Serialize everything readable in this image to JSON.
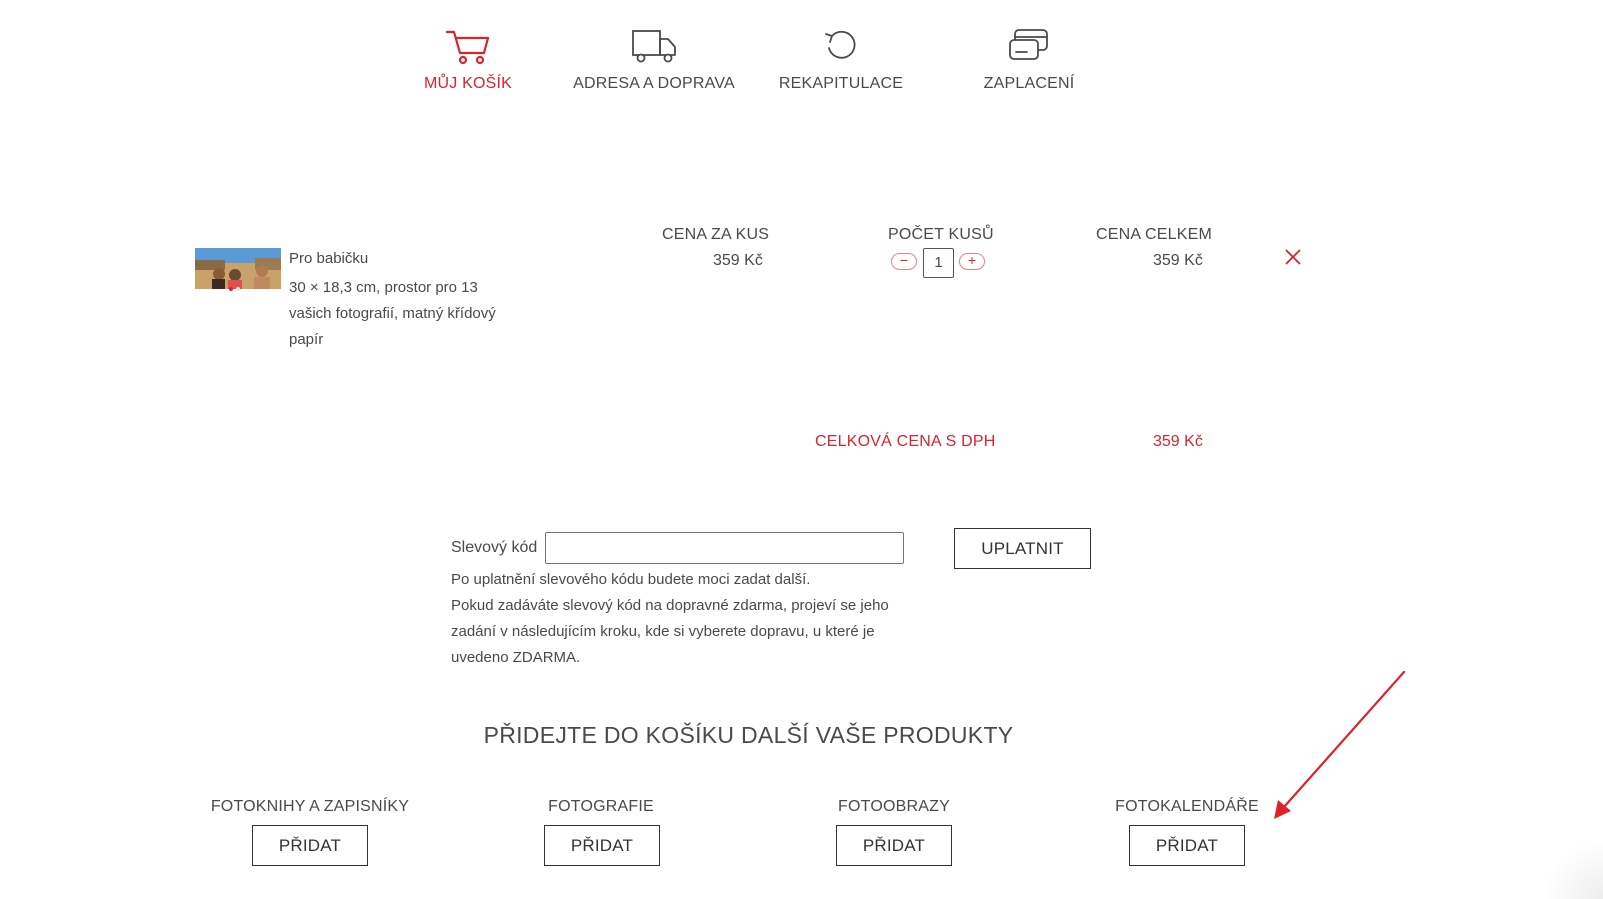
{
  "steps": [
    {
      "label": "MŮJ KOŠÍK",
      "icon": "cart-icon",
      "active": true
    },
    {
      "label": "ADRESA A DOPRAVA",
      "icon": "truck-icon",
      "active": false
    },
    {
      "label": "REKAPITULACE",
      "icon": "undo-arrow-icon",
      "active": false
    },
    {
      "label": "ZAPLACENÍ",
      "icon": "credit-card-icon",
      "active": false
    }
  ],
  "cart": {
    "headers": {
      "unit_price": "CENA ZA KUS",
      "quantity": "POČET KUSŮ",
      "total_price": "CENA CELKEM"
    },
    "items": [
      {
        "name": "Pro babičku",
        "description": "30 × 18,3 cm, prostor pro 13 vašich fotografií, matný křídový papír",
        "unit_price": "359 Kč",
        "quantity": "1",
        "total_price": "359 Kč",
        "minus_symbol": "−",
        "plus_symbol": "+"
      }
    ],
    "grand_total_label": "CELKOVÁ CENA S DPH",
    "grand_total_value": "359 Kč"
  },
  "discount": {
    "label": "Slevový kód",
    "input_value": "",
    "apply_button": "UPLATNIT",
    "note": "Po uplatnění slevového kódu budete moci zadat další.\nPokud zadáváte slevový kód na dopravné zdarma, projeví se jeho zadání v následujícím kroku, kde si vyberete dopravu, u které je uvedeno ZDARMA."
  },
  "more_products": {
    "title": "PŘIDEJTE DO KOŠÍKU DALŠÍ VAŠE PRODUKTY",
    "items": [
      {
        "label": "FOTOKNIHY A ZAPISNÍKY",
        "button": "PŘIDAT"
      },
      {
        "label": "FOTOGRAFIE",
        "button": "PŘIDAT"
      },
      {
        "label": "FOTOOBRAZY",
        "button": "PŘIDAT"
      },
      {
        "label": "FOTOKALENDÁŘE",
        "button": "PŘIDAT"
      }
    ]
  },
  "colors": {
    "accent": "#d9232e",
    "text": "#4a4a4a",
    "annotation_arrow": "#e0202a"
  }
}
